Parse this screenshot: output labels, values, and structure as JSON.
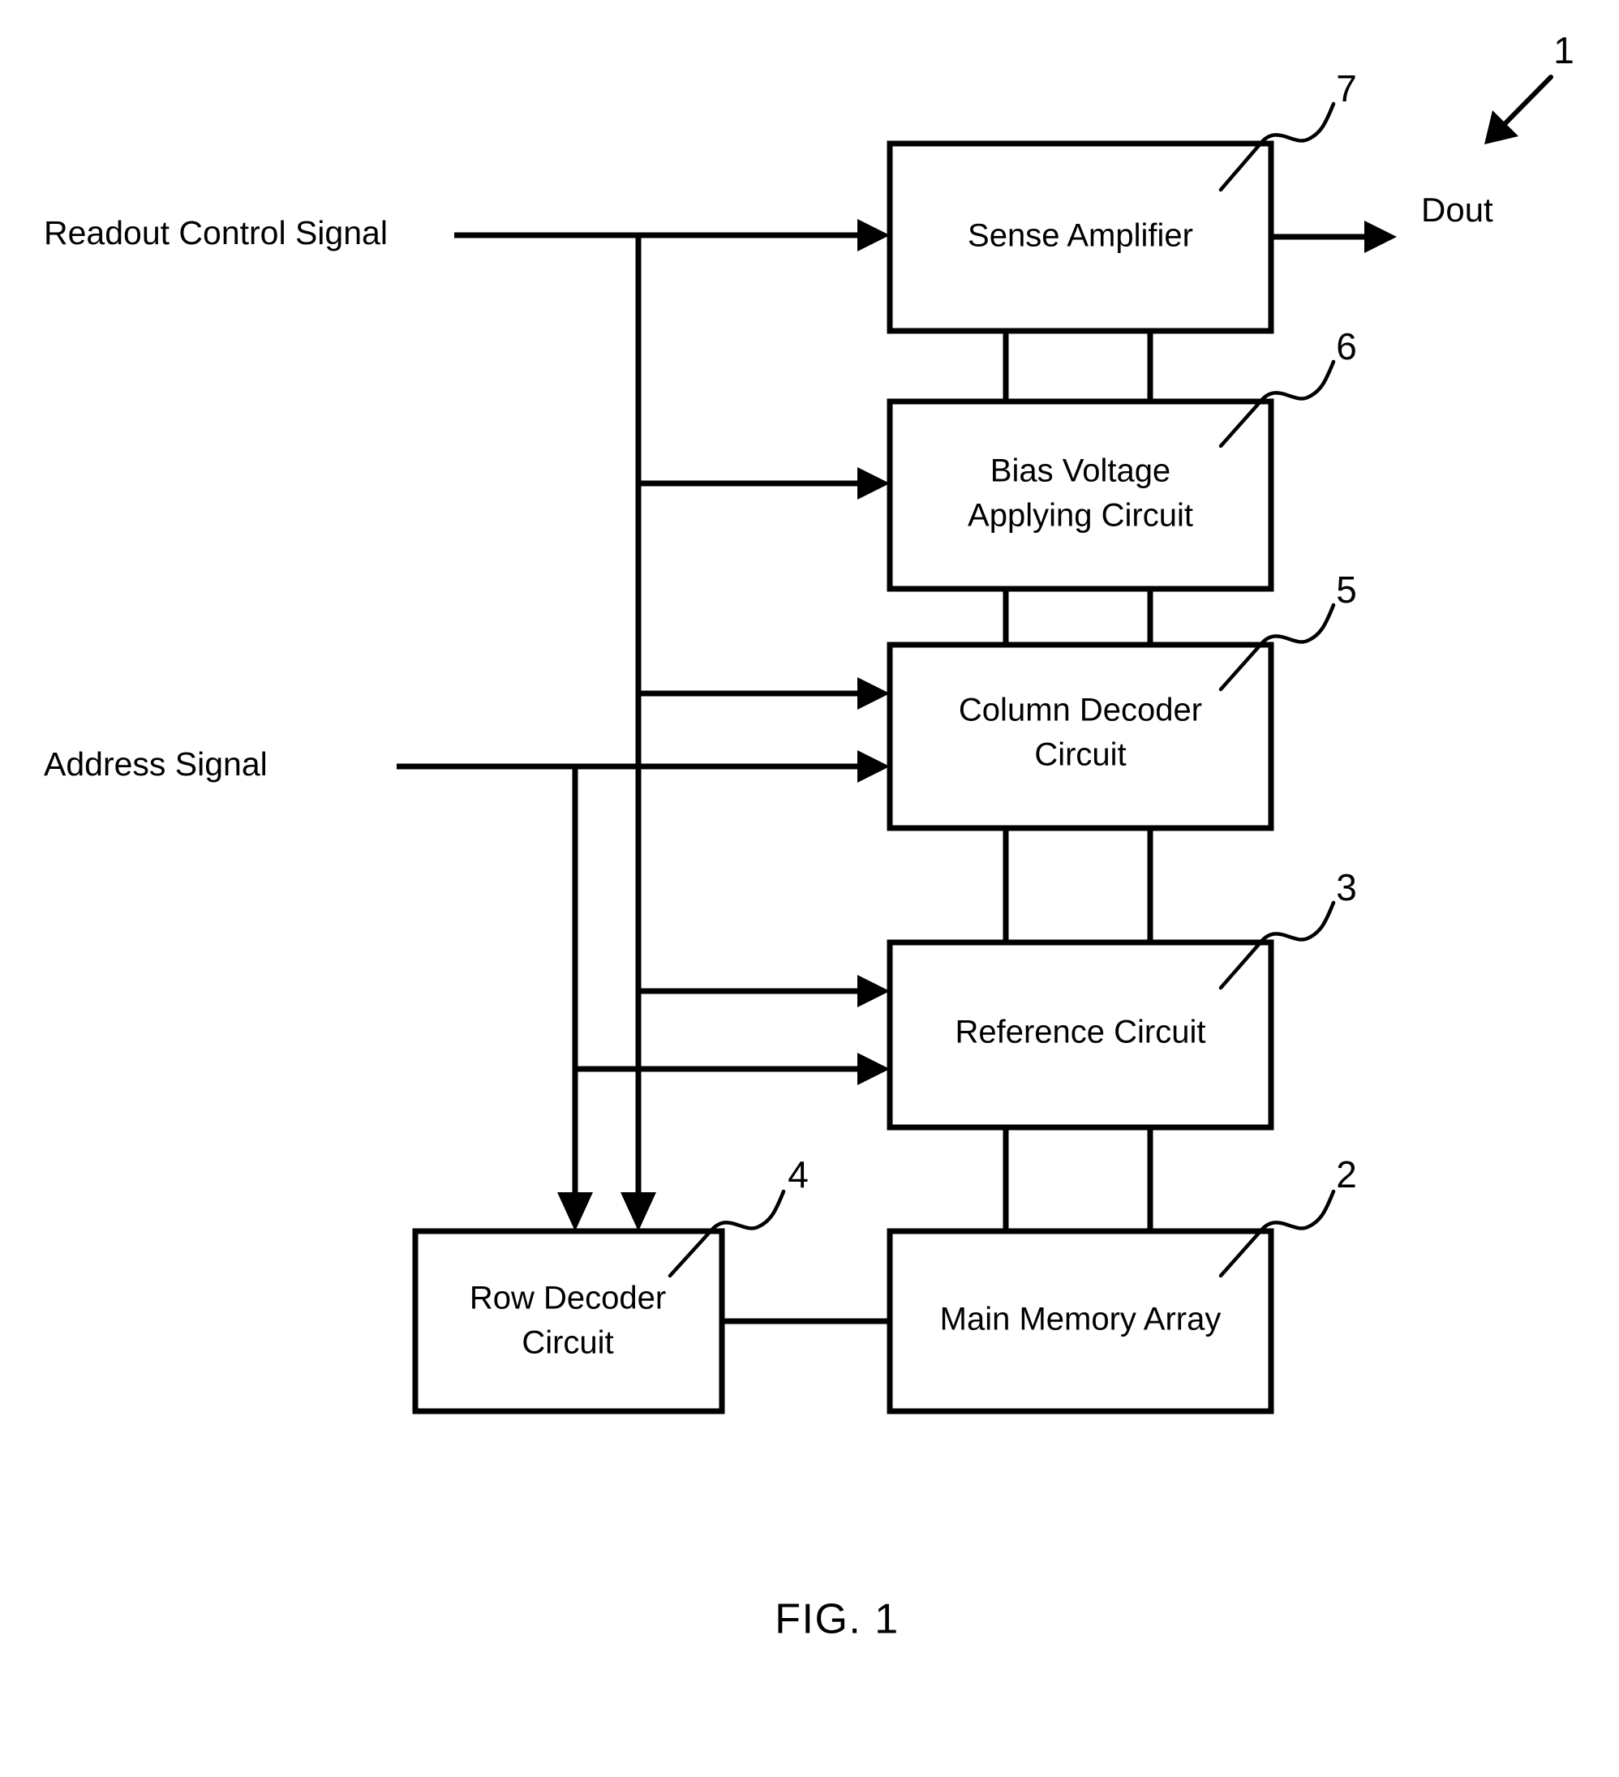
{
  "figure": {
    "caption": "FIG. 1",
    "overall_ref": "1"
  },
  "signals": {
    "readout": "Readout Control Signal",
    "address": "Address Signal",
    "output": "Dout"
  },
  "blocks": [
    {
      "id": "sense-amplifier",
      "label": "Sense Amplifier",
      "ref": "7"
    },
    {
      "id": "bias-voltage",
      "label_line1": "Bias Voltage",
      "label_line2": "Applying Circuit",
      "ref": "6"
    },
    {
      "id": "column-decoder",
      "label_line1": "Column Decoder",
      "label_line2": "Circuit",
      "ref": "5"
    },
    {
      "id": "reference-circuit",
      "label": "Reference Circuit",
      "ref": "3"
    },
    {
      "id": "row-decoder",
      "label_line1": "Row Decoder",
      "label_line2": "Circuit",
      "ref": "4"
    },
    {
      "id": "main-memory-array",
      "label": "Main Memory Array",
      "ref": "2"
    }
  ],
  "colors": {
    "ink": "#000000",
    "paper": "#ffffff"
  }
}
